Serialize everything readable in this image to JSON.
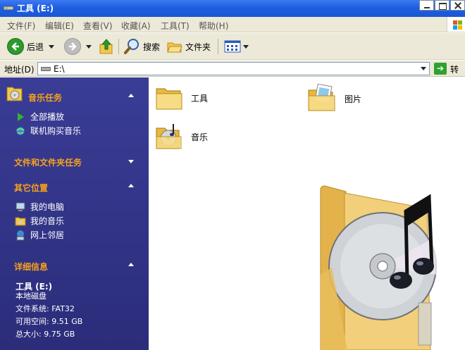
{
  "window": {
    "title": "工具 (E:)"
  },
  "menu": [
    "文件(F)",
    "编辑(E)",
    "查看(V)",
    "收藏(A)",
    "工具(T)",
    "帮助(H)"
  ],
  "toolbar": {
    "back": "后退",
    "search": "搜索",
    "folders": "文件夹"
  },
  "address": {
    "label": "地址(D)",
    "value": "E:\\",
    "go": "转到"
  },
  "sidebar": {
    "music_tasks": {
      "title": "音乐任务",
      "items": [
        "全部播放",
        "联机购买音乐"
      ]
    },
    "file_tasks": {
      "title": "文件和文件夹任务"
    },
    "other_places": {
      "title": "其它位置",
      "items": [
        "我的电脑",
        "我的音乐",
        "网上邻居"
      ]
    },
    "details": {
      "title": "详细信息",
      "name": "工具 (E:)",
      "type": "本地磁盘",
      "filesystem": "文件系统: FAT32",
      "free": "可用空间: 9.51 GB",
      "total": "总大小: 9.75 GB"
    }
  },
  "files": [
    {
      "name": "工具",
      "icon": "folder-icon"
    },
    {
      "name": "图片",
      "icon": "picture-folder-icon"
    },
    {
      "name": "音乐",
      "icon": "music-folder-icon"
    }
  ],
  "colors": {
    "sidebar": "#2f3186",
    "section_title": "#f7a21b",
    "titlebar": "#1f5fe0"
  }
}
